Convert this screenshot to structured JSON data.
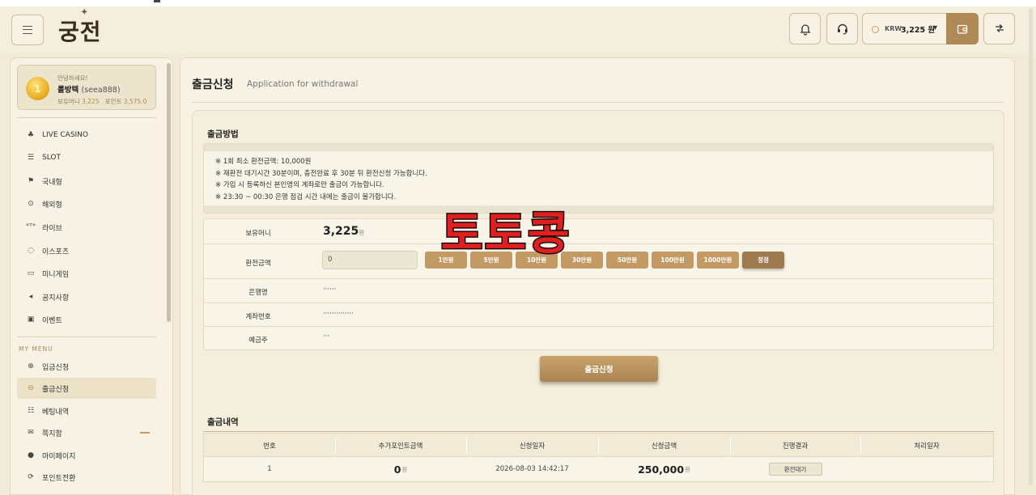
{
  "header": {
    "logo": "궁전",
    "currency": "KRW",
    "balance": "3,225 원"
  },
  "user": {
    "greeting": "안녕하세요!",
    "name": "롤방텍",
    "id": "(seea888)",
    "money_label": "보유머니",
    "money": "3,225",
    "point_label": "포인트",
    "point": "3,575.0",
    "avatar_glyph": "1"
  },
  "sidebar": {
    "items": [
      {
        "label": "LIVE CASINO",
        "icon": "cards-icon"
      },
      {
        "label": "SLOT",
        "icon": "slot-icon"
      },
      {
        "label": "국내형",
        "icon": "flag-icon"
      },
      {
        "label": "해외형",
        "icon": "globe-icon"
      },
      {
        "label": "라이브",
        "icon": "live-icon"
      },
      {
        "label": "이스포츠",
        "icon": "headset-icon"
      },
      {
        "label": "미니게임",
        "icon": "gamepad-icon"
      },
      {
        "label": "공지사항",
        "icon": "megaphone-icon"
      },
      {
        "label": "이벤트",
        "icon": "gift-icon"
      }
    ],
    "my_menu_title": "MY MENU",
    "my_items": [
      {
        "label": "입금신청",
        "icon": "plus-circle-icon"
      },
      {
        "label": "출금신청",
        "icon": "minus-circle-icon"
      },
      {
        "label": "베팅내역",
        "icon": "list-icon"
      },
      {
        "label": "쪽지함",
        "icon": "envelope-icon"
      },
      {
        "label": "마이페이지",
        "icon": "user-icon"
      },
      {
        "label": "포인트전환",
        "icon": "refresh-icon"
      }
    ]
  },
  "page": {
    "title": "출금신청",
    "subtitle": "Application for withdrawal",
    "method_title": "출금방법",
    "notices": [
      "※ 1회 최소 환전금액: 10,000원",
      "※ 재환전 대기시간 30분이며, 충전완료 후 30분 뒤 환전신청 가능합니다.",
      "※ 가입 시 등록하신 본인명의 계좌로만 출금이 가능합니다.",
      "※ 23:30 ~ 00:30 은행 점검 시간 내에는 출금이 불가합니다."
    ],
    "form": {
      "balance_label": "보유머니",
      "balance_value": "3,225",
      "balance_unit": "원",
      "amount_label": "환전금액",
      "amount_value": "0",
      "amount_buttons": [
        "1만원",
        "5만원",
        "10만원",
        "30만원",
        "50만원",
        "100만원",
        "1000만원"
      ],
      "reset_label": "정정",
      "bank_label": "은행명",
      "bank_value": "······",
      "account_label": "계좌번호",
      "account_value": "··············",
      "holder_label": "예금주",
      "holder_value": "···"
    },
    "submit_label": "출금신청",
    "history_title": "출금내역",
    "history_headers": [
      "번호",
      "추가포인트금액",
      "신청일자",
      "신청금액",
      "진행결과",
      "처리일자"
    ],
    "history_rows": [
      {
        "no": "1",
        "bonus": "0",
        "bonus_unit": "원",
        "date": "2026-08-03 14:42:17",
        "amount": "250,000",
        "amount_unit": "원",
        "status": "환전대기",
        "processed": ""
      }
    ]
  },
  "watermark": "토토콩"
}
